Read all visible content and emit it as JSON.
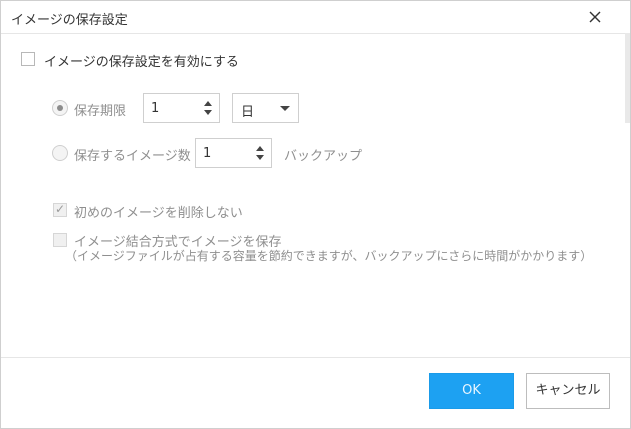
{
  "dialog": {
    "title": "イメージの保存設定",
    "close_icon": "close-icon"
  },
  "enable_setting": {
    "label": "イメージの保存設定を有効にする",
    "checked": false
  },
  "retention_period": {
    "label": "保存期限",
    "selected": true,
    "value": "1",
    "unit_selected": "日"
  },
  "image_count": {
    "label": "保存するイメージ数",
    "selected": false,
    "value": "1",
    "suffix": "バックアップ"
  },
  "keep_first": {
    "label": "初めのイメージを削除しない",
    "checked": true
  },
  "merge_mode": {
    "label": "イメージ結合方式でイメージを保存",
    "note": "（イメージファイルが占有する容量を節約できますが、バックアップにさらに時間がかかります）",
    "checked": false
  },
  "footer": {
    "ok_label": "OK",
    "cancel_label": "キャンセル"
  },
  "colors": {
    "accent": "#1da1f2",
    "border": "#cfcfcf",
    "muted_text": "#8f8f8f"
  }
}
